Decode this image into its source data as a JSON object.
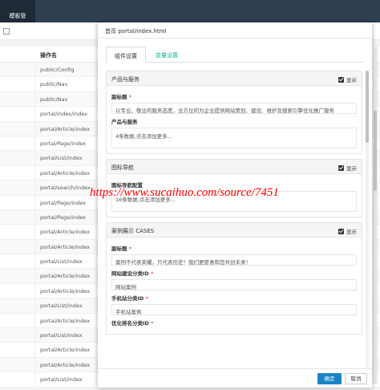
{
  "app": {
    "tab_label": "模板管理"
  },
  "table": {
    "header": "操作名",
    "rows": [
      "public/Config",
      "public/Nav",
      "public/Nav",
      "portal/index/index",
      "portal/Article/index",
      "portal/Page/index",
      "portal/List/index",
      "portal/Article/index",
      "portal/search/index",
      "portal/Page/index",
      "portal/Page/index",
      "portal/Article/index",
      "portal/Article/index",
      "portal/List/index",
      "portal/Article/index",
      "portal/Article/index",
      "portal/List/index",
      "portal/Article/index",
      "portal/List/index",
      "portal/Article/index",
      "portal/Article/index",
      "portal/List/index"
    ]
  },
  "modal": {
    "title": "首页 portal/index.html",
    "close": "×",
    "tabs": {
      "component": "组件设置",
      "variable": "变量设置"
    },
    "sections": {
      "product": {
        "title": "产品与服务",
        "show": "显示",
        "subtitle_label": "副标题",
        "subtitle_value": "以专业、敬业的服务态度，全方位的为企业提供网站策划、建设、维护及搜索引擎优化推广服务",
        "products_label": "产品与服务",
        "products_value": "4条数据,点击添加更多..."
      },
      "iconnav": {
        "title": "图标导航",
        "show": "显示",
        "field_label": "图标导航配置",
        "field_value": "16条数据,点击添加更多..."
      },
      "cases": {
        "title": "案例展示 CASES",
        "show": "显示",
        "subtitle_label": "副标题",
        "subtitle_value": "案例不代表荣耀，只代表历史！我们更愿意和您共创未来！",
        "site_cat_label": "网站建设分类ID",
        "site_cat_value": "网站案例",
        "mobile_cat_label": "手机站分类ID",
        "mobile_cat_value": "手机站案例",
        "seo_cat_label": "优化排名分类ID"
      }
    },
    "buttons": {
      "ok": "确定",
      "cancel": "取消"
    }
  },
  "watermark": "https://www.sucaihuo.com/source/7451",
  "colors": {
    "accent": "#1ab394",
    "primary_button": "#1c84c6",
    "required": "#ed5565",
    "topbar": "#2f4050",
    "watermark": "#ff0000"
  }
}
